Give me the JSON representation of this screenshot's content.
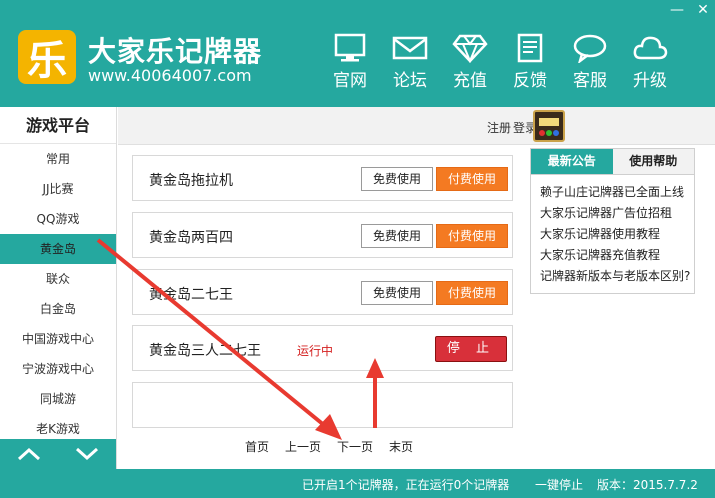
{
  "window": {
    "minimize": "—",
    "close": "✕"
  },
  "brand": {
    "logo_char": "乐",
    "title": "大家乐记牌器",
    "url": "www.40064007.com"
  },
  "nav": [
    {
      "label": "官网",
      "icon": "monitor-icon"
    },
    {
      "label": "论坛",
      "icon": "mail-icon"
    },
    {
      "label": "充值",
      "icon": "diamond-icon"
    },
    {
      "label": "反馈",
      "icon": "document-icon"
    },
    {
      "label": "客服",
      "icon": "chat-bubble-icon"
    },
    {
      "label": "升级",
      "icon": "cloud-icon"
    }
  ],
  "sidebar": {
    "title": "游戏平台",
    "items": [
      {
        "label": "常用"
      },
      {
        "label": "JJ比赛"
      },
      {
        "label": "QQ游戏"
      },
      {
        "label": "黄金岛",
        "active": true
      },
      {
        "label": "联众"
      },
      {
        "label": "白金岛"
      },
      {
        "label": "中国游戏中心"
      },
      {
        "label": "宁波游戏中心"
      },
      {
        "label": "同城游"
      },
      {
        "label": "老K游戏"
      }
    ]
  },
  "topbar": {
    "register": "注册",
    "login": "登录"
  },
  "games": [
    {
      "name": "黄金岛拖拉机",
      "free": "免费使用",
      "paid": "付费使用"
    },
    {
      "name": "黄金岛两百四",
      "free": "免费使用",
      "paid": "付费使用"
    },
    {
      "name": "黄金岛二七王",
      "free": "免费使用",
      "paid": "付费使用"
    },
    {
      "name": "黄金岛三人二七王",
      "status": "运行中",
      "stop": "停 止"
    }
  ],
  "pager": {
    "first": "首页",
    "prev": "上一页",
    "next": "下一页",
    "last": "末页"
  },
  "panel": {
    "tabs": [
      {
        "label": "最新公告",
        "active": true
      },
      {
        "label": "使用帮助"
      }
    ],
    "news": [
      "赖子山庄记牌器已全面上线",
      "大家乐记牌器广告位招租",
      "大家乐记牌器使用教程",
      "大家乐记牌器充值教程",
      "记牌器新版本与老版本区别?"
    ]
  },
  "status": {
    "message": "已开启1个记牌器，正在运行0个记牌器",
    "stop_all": "一键停止",
    "version": "版本：2015.7.7.2"
  },
  "colors": {
    "teal": "#25a89f",
    "orange": "#f47a22",
    "red": "#d8303a",
    "arrow": "#e83a30"
  }
}
